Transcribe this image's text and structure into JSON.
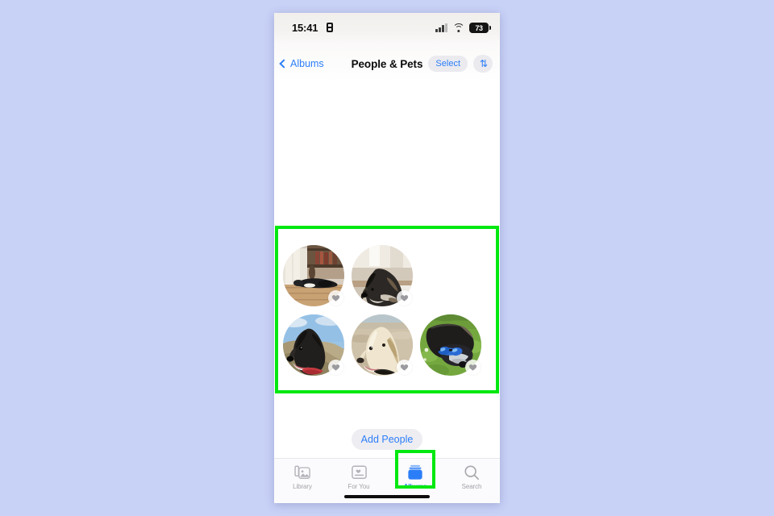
{
  "background_color": "#c8d1f6",
  "highlight_color": "#00e810",
  "accent_color": "#2c7ef8",
  "status_bar": {
    "time": "15:41",
    "time_icon": "recording-indicator-icon",
    "cellular_icon": "cellular-signal-icon",
    "wifi_icon": "wifi-icon",
    "battery_level": "73",
    "battery_icon": "battery-icon"
  },
  "nav_bar": {
    "back_label": "Albums",
    "back_icon": "chevron-left-icon",
    "title": "People & Pets",
    "select_label": "Select",
    "sort_icon": "sort-arrows-icon",
    "sort_glyph": "⇅"
  },
  "grid": {
    "pets": [
      {
        "name": "black-dog-on-floor",
        "favorite": true,
        "heart_icon": "heart-icon"
      },
      {
        "name": "black-and-white-dog-indoors",
        "favorite": true,
        "heart_icon": "heart-icon"
      },
      {
        "name": "black-dog-red-collar-dunes",
        "favorite": true,
        "heart_icon": "heart-icon"
      },
      {
        "name": "golden-retriever-on-sand",
        "favorite": true,
        "heart_icon": "heart-icon"
      },
      {
        "name": "black-dog-sunglasses-grass",
        "favorite": true,
        "heart_icon": "heart-icon"
      }
    ]
  },
  "footer": {
    "add_people_label": "Add People"
  },
  "tab_bar": {
    "tabs": [
      {
        "label": "Library",
        "icon": "photo-stack-icon",
        "active": false
      },
      {
        "label": "For You",
        "icon": "for-you-card-icon",
        "active": false
      },
      {
        "label": "Albums",
        "icon": "albums-stack-icon",
        "active": true
      },
      {
        "label": "Search",
        "icon": "magnifier-icon",
        "active": false
      }
    ]
  }
}
